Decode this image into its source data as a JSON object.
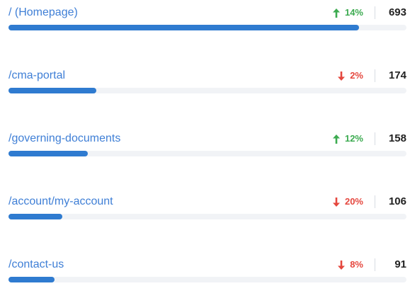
{
  "pages": [
    {
      "path": "/ (Homepage)",
      "trend": "up",
      "change": "14%",
      "views": "693",
      "bar_fraction": 0.88
    },
    {
      "path": "/cma-portal",
      "trend": "down",
      "change": "2%",
      "views": "174",
      "bar_fraction": 0.22
    },
    {
      "path": "/governing-documents",
      "trend": "up",
      "change": "12%",
      "views": "158",
      "bar_fraction": 0.2
    },
    {
      "path": "/account/my-account",
      "trend": "down",
      "change": "20%",
      "views": "106",
      "bar_fraction": 0.135
    },
    {
      "path": "/contact-us",
      "trend": "down",
      "change": "8%",
      "views": "91",
      "bar_fraction": 0.115
    }
  ],
  "colors": {
    "link": "#3f7fd6",
    "up": "#3dab51",
    "down": "#e5483f",
    "bar_fill": "#2f7bd0",
    "bar_track": "#f1f3f6"
  },
  "icons": {
    "up": "arrow-up-icon",
    "down": "arrow-down-icon"
  }
}
